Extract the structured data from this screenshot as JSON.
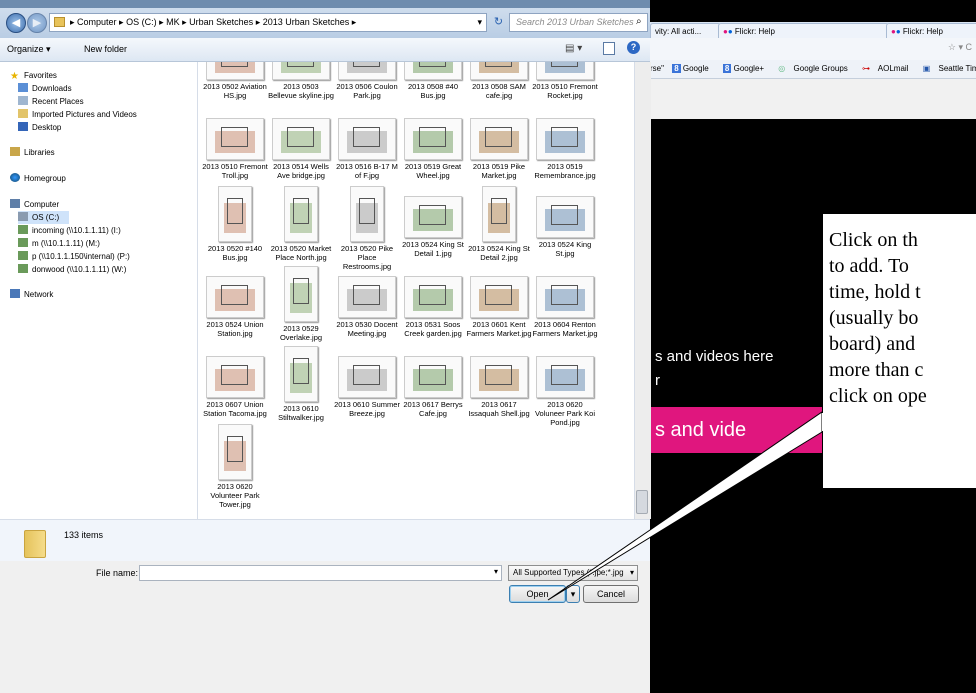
{
  "browser": {
    "tabs": [
      "vity: All acti...",
      "Flickr: Help",
      "Flickr: Help"
    ],
    "bookmarks": [
      "rse\"",
      "Google",
      "Google+",
      "Google Groups",
      "AOLmail",
      "Seattle Times",
      "M"
    ],
    "upload_text": "s and videos here",
    "or_text": "r",
    "pink_button": "s and vide"
  },
  "callout": {
    "lines": [
      "Click on th",
      "to add.  To",
      "time, hold t",
      "(usually bo",
      "board) and",
      "more than c",
      "click on ope"
    ]
  },
  "dialog": {
    "address": {
      "crumbs": [
        "Computer",
        "OS (C:)",
        "MK",
        "Urban Sketches",
        "2013 Urban Sketches"
      ]
    },
    "search_placeholder": "Search 2013 Urban Sketches",
    "toolbar": {
      "organize": "Organize ▾",
      "new_folder": "New folder"
    },
    "nav": {
      "favorites": "Favorites",
      "downloads": "Downloads",
      "recent": "Recent Places",
      "imported": "Imported Pictures and Videos",
      "desktop": "Desktop",
      "libraries": "Libraries",
      "homegroup": "Homegroup",
      "computer": "Computer",
      "os": "OS (C:)",
      "incoming": "incoming (\\\\10.1.1.11) (I:)",
      "m": "m (\\\\10.1.1.11) (M:)",
      "p": "p (\\\\10.1.1.150\\internal) (P:)",
      "donwood": "donwood (\\\\10.1.1.11) (W:)",
      "network": "Network"
    },
    "files": [
      "2013 0502 Aviation HS.jpg",
      "2013 0503 Bellevue skyline.jpg",
      "2013 0506 Coulon Park.jpg",
      "2013 0508 #40 Bus.jpg",
      "2013 0508 SAM cafe.jpg",
      "2013 0510 Fremont Rocket.jpg",
      "2013 0510 Fremont Troll.jpg",
      "2013 0514 Wells Ave bridge.jpg",
      "2013 0516 B-17 M of F.jpg",
      "2013 0519 Great Wheel.jpg",
      "2013 0519 Pike Market.jpg",
      "2013 0519 Remembrance.jpg",
      "2013 0520 #140 Bus.jpg",
      "2013 0520 Market Place North.jpg",
      "2013 0520 Pike Place Restrooms.jpg",
      "2013 0524 King St Detail 1.jpg",
      "2013 0524 King St Detail 2.jpg",
      "2013 0524 King St.jpg",
      "2013 0524 Union Station.jpg",
      "2013 0529 Overlake.jpg",
      "2013 0530 Docent Meeting.jpg",
      "2013 0531 Soos Creek garden.jpg",
      "2013 0601 Kent Farmers Market.jpg",
      "2013 0604 Renton Farmers Market.jpg",
      "2013 0607 Union Station Tacoma.jpg",
      "2013 0610 Stiltwalker.jpg",
      "2013 0610 Summer Breeze.jpg",
      "2013 0617 Berrys Cafe.jpg",
      "2013 0617 Issaquah Shell.jpg",
      "2013 0620 Voluneer Park Koi Pond.jpg",
      "2013 0620 Volunteer Park Tower.jpg"
    ],
    "item_count": "133 items",
    "file_name_label": "File name:",
    "file_name_value": "",
    "file_type": "All Supported Types (*.jpe;*.jpg",
    "open_label": "Open",
    "cancel_label": "Cancel"
  }
}
